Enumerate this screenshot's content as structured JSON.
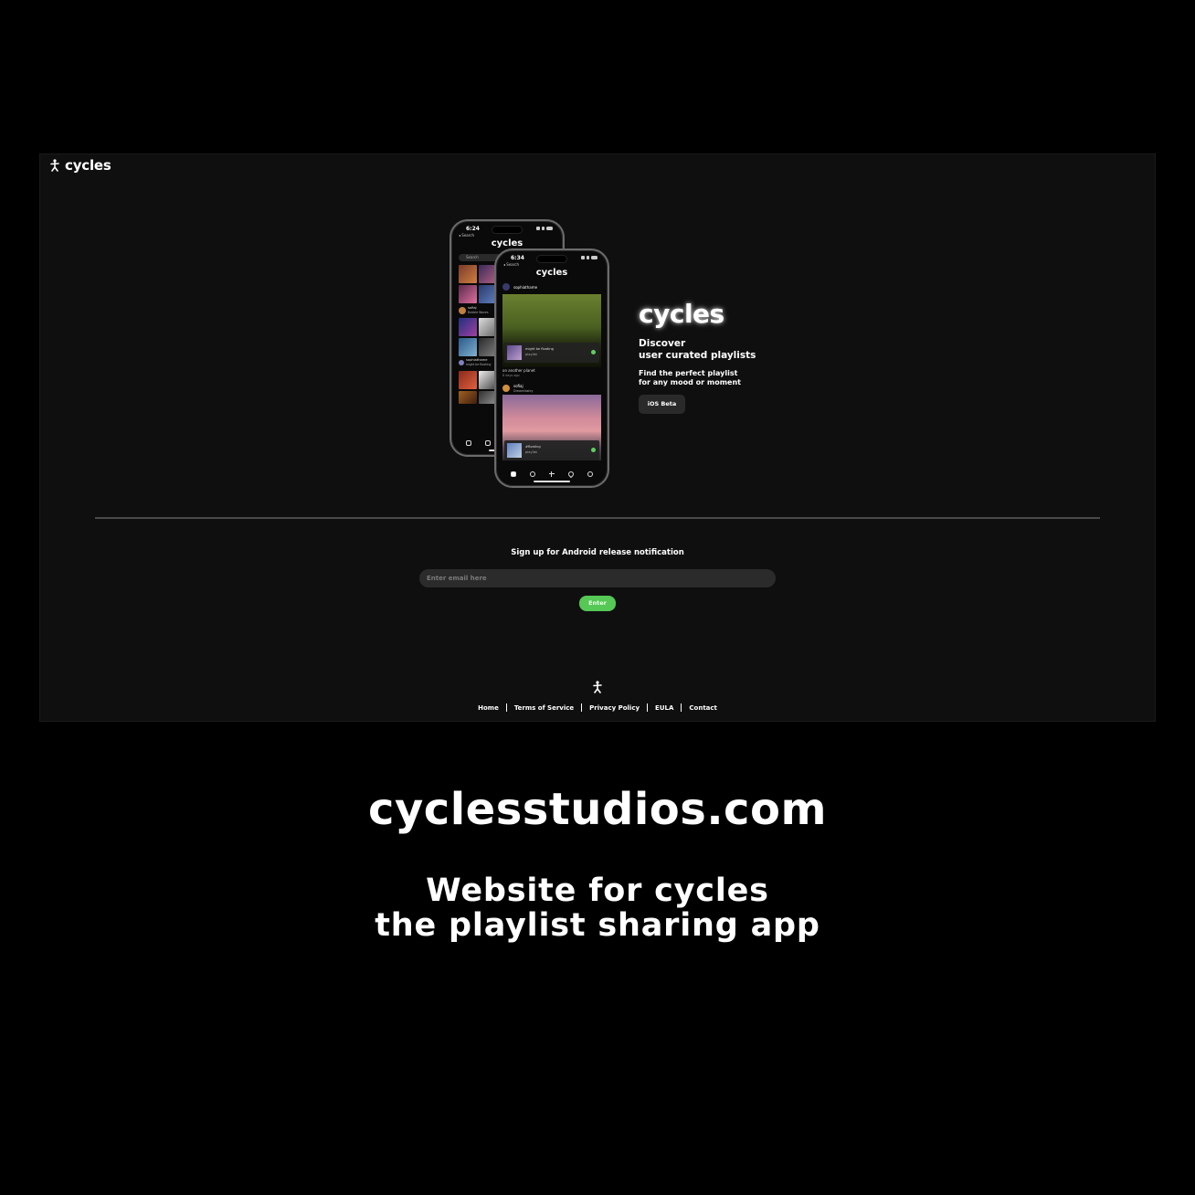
{
  "site": {
    "logo_text": "cycles",
    "hero": {
      "title": "cycles",
      "subtitle_line1": "Discover",
      "subtitle_line2": "user curated playlists",
      "tagline_line1": "Find the perfect playlist",
      "tagline_line2": "for any mood or moment",
      "ios_button": "iOS Beta"
    },
    "phone_back": {
      "time": "6:24",
      "back_label": "◂ Search",
      "title": "cycles",
      "search_placeholder": "Search",
      "user1": "sofiaj",
      "user1_sub": "Bubble Waves",
      "user2": "sophiathame",
      "user2_sub": "might be floating"
    },
    "phone_front": {
      "time": "6:34",
      "back_label": "◂ Search",
      "title": "cycles",
      "post1_user": "sophiathame",
      "post1_card_title": "might be floating",
      "post1_card_sub": "playlist",
      "post1_caption": "on another planet",
      "post1_time": "8 days ago",
      "post2_user": "sofiaj",
      "post2_user_sub": "Dreamfasley",
      "post2_card_title": "#floating",
      "post2_card_sub": "playlist"
    },
    "signup": {
      "label": "Sign up for Android release notification",
      "email_placeholder": "Enter email here",
      "enter_button": "Enter"
    },
    "footer": {
      "links": [
        "Home",
        "Terms of Service",
        "Privacy Policy",
        "EULA",
        "Contact"
      ]
    },
    "colors": {
      "background": "#0f0f0f",
      "accent_green": "#55c855",
      "input_bg": "#2b2b2b"
    }
  },
  "caption": {
    "domain": "cyclesstudios.com",
    "line1": "Website for cycles",
    "line2": "the playlist sharing app"
  }
}
